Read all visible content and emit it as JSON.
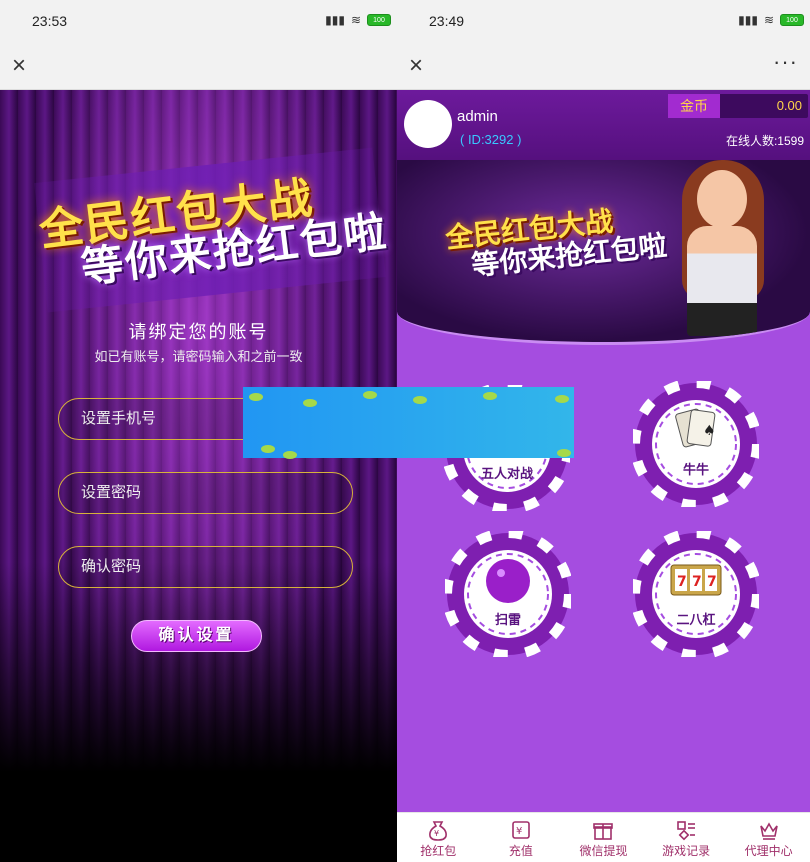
{
  "left": {
    "status": {
      "time": "23:53",
      "battery": "100"
    },
    "nav": {
      "close": "×",
      "more": "···"
    },
    "banner": {
      "line1": "全民红包大战",
      "line2": "等你来抢红包啦"
    },
    "heading": "请绑定您的账号",
    "subheading": "如已有账号，请密码输入和之前一致",
    "fields": {
      "phone_placeholder": "设置手机号",
      "password_placeholder": "设置密码",
      "confirm_placeholder": "确认密码"
    },
    "confirm_button": "确认设置"
  },
  "right": {
    "status": {
      "time": "23:49",
      "battery": "100"
    },
    "nav": {
      "close": "×",
      "more": "···"
    },
    "user": {
      "name": "admin",
      "id": "( ID:3292 )"
    },
    "coins": {
      "label": "金币",
      "value": "0.00"
    },
    "online": "在线人数:1599",
    "banner": {
      "line1": "全民红包大战",
      "line2": "等你来抢红包啦"
    },
    "games": [
      {
        "label": "五人对战",
        "icon": "ribbon-icon"
      },
      {
        "label": "牛牛",
        "icon": "playing-cards-icon"
      },
      {
        "label": "扫雷",
        "icon": "bomb-ball-icon"
      },
      {
        "label": "二八杠",
        "icon": "slot-machine-icon"
      }
    ],
    "tabs": [
      {
        "label": "抢红包",
        "icon": "money-bag-icon"
      },
      {
        "label": "充值",
        "icon": "recharge-icon"
      },
      {
        "label": "微信提现",
        "icon": "gift-icon"
      },
      {
        "label": "游戏记录",
        "icon": "records-icon"
      },
      {
        "label": "代理中心",
        "icon": "crown-icon"
      }
    ]
  },
  "colors": {
    "accent": "#a54de0",
    "gold": "#ffd54a",
    "field_border": "#d6b23a",
    "tab_text": "#a0306a"
  }
}
